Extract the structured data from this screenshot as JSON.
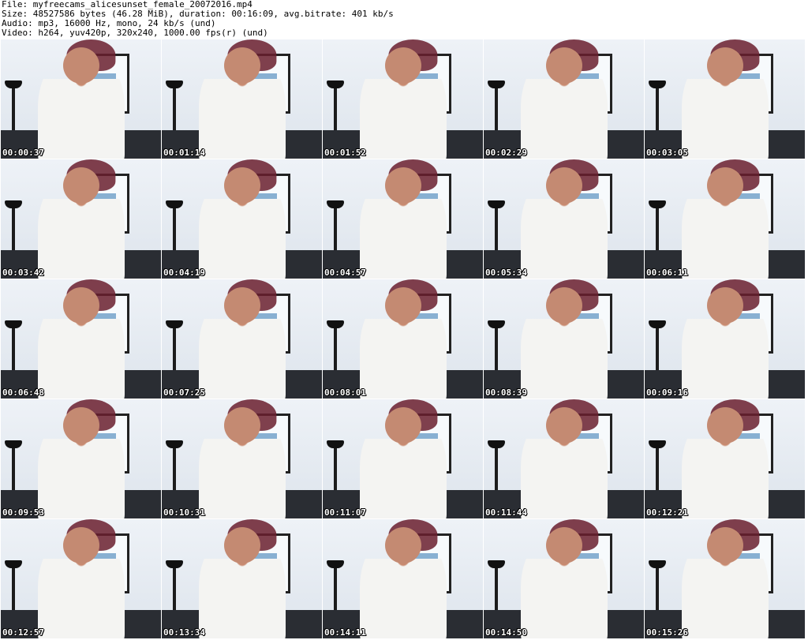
{
  "header": {
    "file_line": "File: myfreecams_alicesunset_female_20072016.mp4",
    "size_line": "Size: 48527586 bytes (46.28 MiB), duration: 00:16:09, avg.bitrate: 401 kb/s",
    "audio_line": "Audio: mp3, 16000 Hz, mono, 24 kb/s (und)",
    "video_line": "Video: h264, yuv420p, 320x240, 1000.00 fps(r) (und)"
  },
  "thumbnails": [
    {
      "timestamp": "00:00:37"
    },
    {
      "timestamp": "00:01:14"
    },
    {
      "timestamp": "00:01:52"
    },
    {
      "timestamp": "00:02:29"
    },
    {
      "timestamp": "00:03:05"
    },
    {
      "timestamp": "00:03:42"
    },
    {
      "timestamp": "00:04:19"
    },
    {
      "timestamp": "00:04:57"
    },
    {
      "timestamp": "00:05:34"
    },
    {
      "timestamp": "00:06:11"
    },
    {
      "timestamp": "00:06:48"
    },
    {
      "timestamp": "00:07:25"
    },
    {
      "timestamp": "00:08:01"
    },
    {
      "timestamp": "00:08:39"
    },
    {
      "timestamp": "00:09:16"
    },
    {
      "timestamp": "00:09:53"
    },
    {
      "timestamp": "00:10:31"
    },
    {
      "timestamp": "00:11:07"
    },
    {
      "timestamp": "00:11:44"
    },
    {
      "timestamp": "00:12:21"
    },
    {
      "timestamp": "00:12:57"
    },
    {
      "timestamp": "00:13:34"
    },
    {
      "timestamp": "00:14:11"
    },
    {
      "timestamp": "00:14:50"
    },
    {
      "timestamp": "00:15:26"
    }
  ]
}
